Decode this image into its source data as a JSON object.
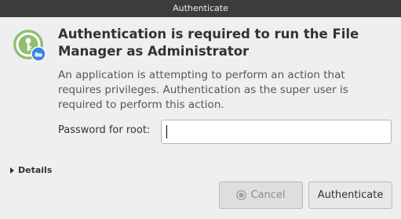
{
  "window": {
    "title": "Authenticate"
  },
  "dialog": {
    "icon": "lock-user-icon",
    "heading": "Authentication is required to run the File Manager as Administrator",
    "description": "An application is attempting to perform an action that requires privileges. Authentication as the super user is required to perform this action.",
    "password_label": "Password for root:",
    "password_value": "",
    "details_label": "Details",
    "details_icon": "chevron-right-icon"
  },
  "buttons": {
    "cancel_label": "Cancel",
    "cancel_icon": "cancel-icon",
    "authenticate_label": "Authenticate"
  },
  "colors": {
    "titlebar": "#3c3d3b",
    "background": "#efefef",
    "icon_green": "#8fbf6f",
    "icon_badge_blue": "#3584e4"
  }
}
